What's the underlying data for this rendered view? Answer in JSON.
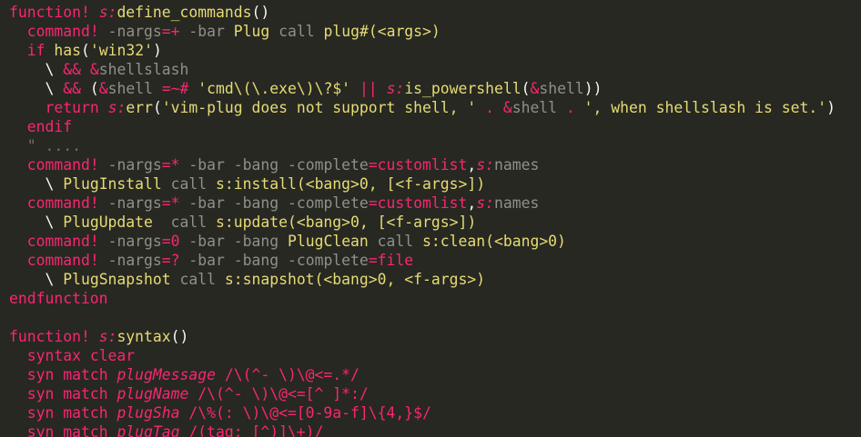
{
  "colors": {
    "background": "#272822",
    "default": "#f8f8f2",
    "keyword": "#f92672",
    "yellow": "#e6db74",
    "comment": "#75715e",
    "dim": "#8f908a"
  },
  "lines": [
    [
      [
        "function!",
        "kw"
      ],
      [
        " ",
        ""
      ],
      [
        "s:",
        "kw it"
      ],
      [
        "define_commands",
        "fn"
      ],
      [
        "()",
        ""
      ]
    ],
    [
      [
        "  ",
        ""
      ],
      [
        "command!",
        "kw"
      ],
      [
        " ",
        ""
      ],
      [
        "-nargs",
        "dim"
      ],
      [
        "=+",
        "kw"
      ],
      [
        " ",
        ""
      ],
      [
        "-bar",
        "dim"
      ],
      [
        " ",
        ""
      ],
      [
        "Plug",
        "fn"
      ],
      [
        " ",
        ""
      ],
      [
        "call",
        "dim"
      ],
      [
        " ",
        ""
      ],
      [
        "plug#(<args>)",
        "fn"
      ]
    ],
    [
      [
        "  ",
        ""
      ],
      [
        "if",
        "kw"
      ],
      [
        " ",
        ""
      ],
      [
        "has",
        "fn"
      ],
      [
        "(",
        ""
      ],
      [
        "'win32'",
        "str"
      ],
      [
        ")",
        ""
      ]
    ],
    [
      [
        "    \\ ",
        ""
      ],
      [
        "&&",
        "kw"
      ],
      [
        " ",
        ""
      ],
      [
        "&",
        "kw"
      ],
      [
        "shellslash",
        "dim"
      ]
    ],
    [
      [
        "    \\ ",
        ""
      ],
      [
        "&&",
        "kw"
      ],
      [
        " (",
        ""
      ],
      [
        "&",
        "kw"
      ],
      [
        "shell",
        "dim"
      ],
      [
        " ",
        ""
      ],
      [
        "=~#",
        "kw"
      ],
      [
        " ",
        ""
      ],
      [
        "'cmd\\(\\.exe\\)\\?$'",
        "str"
      ],
      [
        " ",
        ""
      ],
      [
        "||",
        "kw"
      ],
      [
        " ",
        ""
      ],
      [
        "s:",
        "kw it"
      ],
      [
        "is_powershell",
        "fn"
      ],
      [
        "(",
        ""
      ],
      [
        "&",
        "kw"
      ],
      [
        "shell",
        "dim"
      ],
      [
        "))",
        ""
      ]
    ],
    [
      [
        "    ",
        ""
      ],
      [
        "return",
        "kw"
      ],
      [
        " ",
        ""
      ],
      [
        "s:",
        "kw it"
      ],
      [
        "err",
        "fn"
      ],
      [
        "(",
        ""
      ],
      [
        "'vim-plug does not support shell, '",
        "str"
      ],
      [
        " ",
        ""
      ],
      [
        ".",
        "kw"
      ],
      [
        " ",
        ""
      ],
      [
        "&",
        "kw"
      ],
      [
        "shell",
        "dim"
      ],
      [
        " ",
        ""
      ],
      [
        ".",
        "kw"
      ],
      [
        " ",
        ""
      ],
      [
        "', when shellslash is set.'",
        "str"
      ],
      [
        ")",
        ""
      ]
    ],
    [
      [
        "  ",
        ""
      ],
      [
        "endif",
        "kw"
      ]
    ],
    [
      [
        "  ",
        ""
      ],
      [
        "\" ....",
        "com"
      ]
    ],
    [
      [
        "  ",
        ""
      ],
      [
        "command!",
        "kw"
      ],
      [
        " ",
        ""
      ],
      [
        "-nargs",
        "dim"
      ],
      [
        "=*",
        "kw"
      ],
      [
        " ",
        ""
      ],
      [
        "-bar -bang -complete",
        "dim"
      ],
      [
        "=",
        "kw"
      ],
      [
        "customlist",
        "kw"
      ],
      [
        ",",
        ""
      ],
      [
        "s:",
        "kw it"
      ],
      [
        "names",
        "dim"
      ]
    ],
    [
      [
        "    \\ ",
        ""
      ],
      [
        "PlugInstall",
        "fn"
      ],
      [
        " ",
        ""
      ],
      [
        "call",
        "dim"
      ],
      [
        " ",
        ""
      ],
      [
        "s:install(<bang>0, [<f-args>])",
        "fn"
      ]
    ],
    [
      [
        "  ",
        ""
      ],
      [
        "command!",
        "kw"
      ],
      [
        " ",
        ""
      ],
      [
        "-nargs",
        "dim"
      ],
      [
        "=*",
        "kw"
      ],
      [
        " ",
        ""
      ],
      [
        "-bar -bang -complete",
        "dim"
      ],
      [
        "=",
        "kw"
      ],
      [
        "customlist",
        "kw"
      ],
      [
        ",",
        ""
      ],
      [
        "s:",
        "kw it"
      ],
      [
        "names",
        "dim"
      ]
    ],
    [
      [
        "    \\ ",
        ""
      ],
      [
        "PlugUpdate",
        "fn"
      ],
      [
        "  ",
        ""
      ],
      [
        "call",
        "dim"
      ],
      [
        " ",
        ""
      ],
      [
        "s:update(<bang>0, [<f-args>])",
        "fn"
      ]
    ],
    [
      [
        "  ",
        ""
      ],
      [
        "command!",
        "kw"
      ],
      [
        " ",
        ""
      ],
      [
        "-nargs",
        "dim"
      ],
      [
        "=0",
        "kw"
      ],
      [
        " ",
        ""
      ],
      [
        "-bar -bang",
        "dim"
      ],
      [
        " ",
        ""
      ],
      [
        "PlugClean",
        "fn"
      ],
      [
        " ",
        ""
      ],
      [
        "call",
        "dim"
      ],
      [
        " ",
        ""
      ],
      [
        "s:clean(<bang>0)",
        "fn"
      ]
    ],
    [
      [
        "  ",
        ""
      ],
      [
        "command!",
        "kw"
      ],
      [
        " ",
        ""
      ],
      [
        "-nargs",
        "dim"
      ],
      [
        "=?",
        "kw"
      ],
      [
        " ",
        ""
      ],
      [
        "-bar -bang -complete",
        "dim"
      ],
      [
        "=",
        "kw"
      ],
      [
        "file",
        "kw"
      ]
    ],
    [
      [
        "    \\ ",
        ""
      ],
      [
        "PlugSnapshot",
        "fn"
      ],
      [
        " ",
        ""
      ],
      [
        "call",
        "dim"
      ],
      [
        " ",
        ""
      ],
      [
        "s:snapshot(<bang>0, <f-args>)",
        "fn"
      ]
    ],
    [
      [
        "endfunction",
        "kw"
      ]
    ],
    [],
    [
      [
        "function!",
        "kw"
      ],
      [
        " ",
        ""
      ],
      [
        "s:",
        "kw it"
      ],
      [
        "syntax",
        "fn"
      ],
      [
        "()",
        ""
      ]
    ],
    [
      [
        "  ",
        ""
      ],
      [
        "syntax clear",
        "kw"
      ]
    ],
    [
      [
        "  ",
        ""
      ],
      [
        "syn match",
        "kw"
      ],
      [
        " ",
        ""
      ],
      [
        "plugMessage",
        "kw it"
      ],
      [
        " ",
        ""
      ],
      [
        "/\\(^- \\)\\@<=.*/",
        "kw"
      ]
    ],
    [
      [
        "  ",
        ""
      ],
      [
        "syn match",
        "kw"
      ],
      [
        " ",
        ""
      ],
      [
        "plugName",
        "kw it"
      ],
      [
        " ",
        ""
      ],
      [
        "/\\(^- \\)\\@<=[^ ]*:/",
        "kw"
      ]
    ],
    [
      [
        "  ",
        ""
      ],
      [
        "syn match",
        "kw"
      ],
      [
        " ",
        ""
      ],
      [
        "plugSha",
        "kw it"
      ],
      [
        " ",
        ""
      ],
      [
        "/\\%(: \\)\\@<=[0-9a-f]\\{4,}$/",
        "kw"
      ]
    ],
    [
      [
        "  ",
        ""
      ],
      [
        "syn match",
        "kw"
      ],
      [
        " ",
        ""
      ],
      [
        "plugTag",
        "kw it"
      ],
      [
        " ",
        ""
      ],
      [
        "/(tag: [^)]\\+)/",
        "kw"
      ]
    ]
  ]
}
